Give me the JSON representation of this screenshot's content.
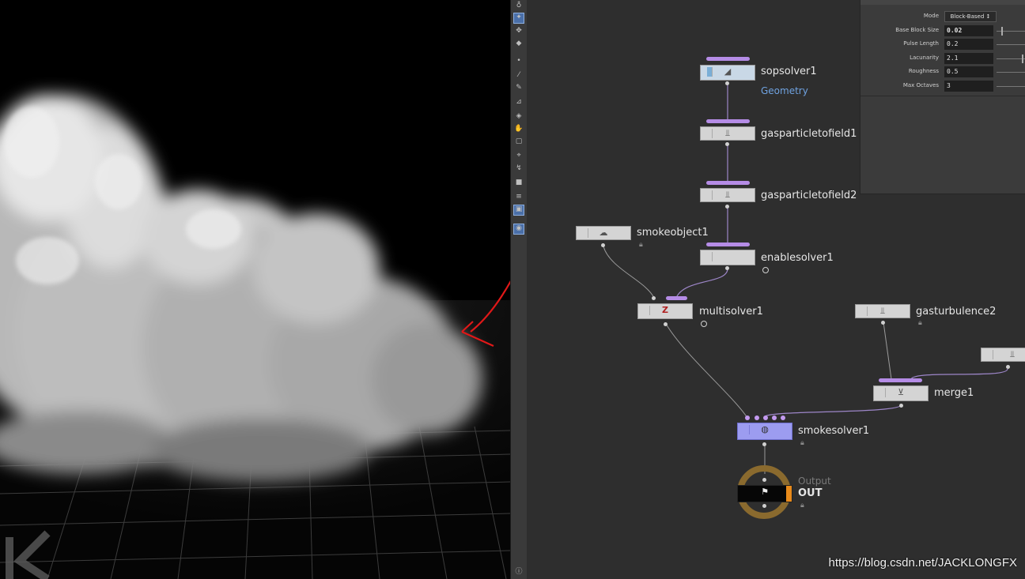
{
  "parameters": {
    "mode": {
      "label": "Mode",
      "value": "Block-Based"
    },
    "base_block_size": {
      "label": "Base Block Size",
      "value": "0.02"
    },
    "pulse_length": {
      "label": "Pulse Length",
      "value": "0.2"
    },
    "lacunarity": {
      "label": "Lacunarity",
      "value": "2.1"
    },
    "roughness": {
      "label": "Roughness",
      "value": "0.5"
    },
    "max_octaves": {
      "label": "Max Octaves",
      "value": "3"
    }
  },
  "nodes": {
    "sopsolver1": {
      "name": "sopsolver1",
      "subtitle": "Geometry"
    },
    "gasparticletofield1": {
      "name": "gasparticletofield1"
    },
    "gasparticletofield2": {
      "name": "gasparticletofield2"
    },
    "smokeobject1": {
      "name": "smokeobject1"
    },
    "enablesolver1": {
      "name": "enablesolver1"
    },
    "multisolver1": {
      "name": "multisolver1"
    },
    "gasturbulence2": {
      "name": "gasturbulence2"
    },
    "merge1": {
      "name": "merge1"
    },
    "smokesolver1": {
      "name": "smokesolver1"
    },
    "output": {
      "type_label": "Output",
      "name": "OUT"
    }
  },
  "icons": {
    "cloud": "smoke-cloud-render",
    "annotation": "red-arrow-annotation",
    "info": "info-icon"
  },
  "colors": {
    "node_flag_purple": "#b58ce6",
    "selected_node": "#9c9cf0",
    "subtitle_blue": "#6fa2e0",
    "annotation_red": "#e01818",
    "output_ring": "#8a6a2e"
  },
  "watermark": "https://blog.csdn.net/JACKLONGFX"
}
